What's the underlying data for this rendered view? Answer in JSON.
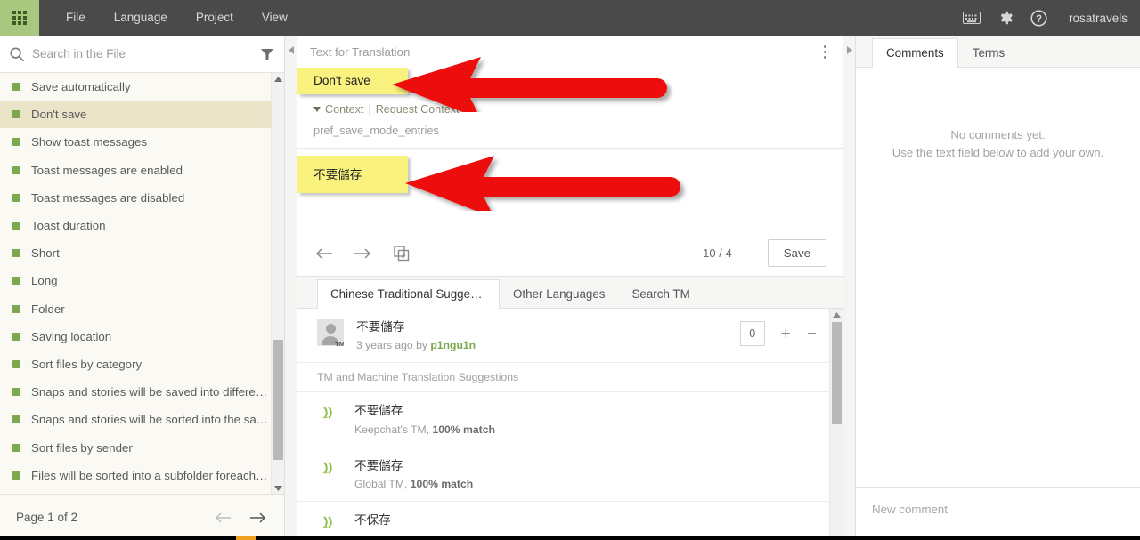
{
  "topbar": {
    "grid_icon": "apps-grid-icon",
    "menu": [
      "File",
      "Language",
      "Project",
      "View"
    ],
    "icons": [
      "keyboard-icon",
      "gear-icon",
      "help-icon"
    ],
    "username": "rosatravels"
  },
  "sidebar": {
    "search": {
      "placeholder": "Search in the File",
      "value": "",
      "icon": "search-icon",
      "filter_icon": "filter-icon"
    },
    "items": [
      {
        "label": "Save automatically",
        "selected": false
      },
      {
        "label": "Don't save",
        "selected": true
      },
      {
        "label": "Show toast messages",
        "selected": false
      },
      {
        "label": "Toast messages are enabled",
        "selected": false
      },
      {
        "label": "Toast messages are disabled",
        "selected": false
      },
      {
        "label": "Toast duration",
        "selected": false
      },
      {
        "label": "Short",
        "selected": false
      },
      {
        "label": "Long",
        "selected": false
      },
      {
        "label": "Folder",
        "selected": false
      },
      {
        "label": "Saving location",
        "selected": false
      },
      {
        "label": "Sort files by category",
        "selected": false
      },
      {
        "label": "Snaps and stories will be saved into different ...",
        "selected": false
      },
      {
        "label": "Snaps and stories will be sorted into the sam...",
        "selected": false
      },
      {
        "label": "Sort files by sender",
        "selected": false
      },
      {
        "label": "Files will be sorted into a subfolder foreach s...",
        "selected": false
      }
    ],
    "pager": {
      "label": "Page 1 of 2",
      "prev_icon": "arrow-left-icon",
      "next_icon": "arrow-right-icon"
    }
  },
  "editor": {
    "header_label": "Text for Translation",
    "kebab_icon": "more-options-icon",
    "source_text": "Don't save",
    "context_toggle": "Context",
    "request_context": "Request Context",
    "context_key": "pref_save_mode_entries",
    "target_text": "不要儲存",
    "toolbar": {
      "prev_icon": "arrow-left-icon",
      "next_icon": "arrow-right-icon",
      "copy_icon": "copy-source-icon",
      "counter": "10 / 4",
      "save_label": "Save"
    }
  },
  "suggestions": {
    "tabs": [
      {
        "label": "Chinese Traditional Suggestio...",
        "active": true
      },
      {
        "label": "Other Languages",
        "active": false
      },
      {
        "label": "Search TM",
        "active": false
      }
    ],
    "user_suggestion": {
      "text": "不要儲存",
      "meta_prefix": "3 years ago by ",
      "author": "p1ngu1n",
      "votes": "0",
      "plus": "+",
      "minus": "−",
      "avatar_badge": "TM"
    },
    "section_header": "TM and Machine Translation Suggestions",
    "tm_items": [
      {
        "text": "不要儲存",
        "source": "Keepchat's TM, ",
        "match": "100% match"
      },
      {
        "text": "不要儲存",
        "source": "Global TM, ",
        "match": "100% match"
      },
      {
        "text": "不保存",
        "source": "",
        "match": ""
      }
    ]
  },
  "comments": {
    "tabs": [
      {
        "label": "Comments",
        "active": true
      },
      {
        "label": "Terms",
        "active": false
      }
    ],
    "empty_line1": "No comments yet.",
    "empty_line2": "Use the text field below to add your own.",
    "new_comment_placeholder": "New comment"
  },
  "colors": {
    "topbar": "#4a4a4a",
    "grid_button": "#a9c77f",
    "selected_row": "#ece4c9",
    "dot_green": "#7ba84e",
    "highlight_yellow": "#f9f27e",
    "annotation_red": "#ee1111",
    "sidebar_bg": "#faf9f4"
  }
}
